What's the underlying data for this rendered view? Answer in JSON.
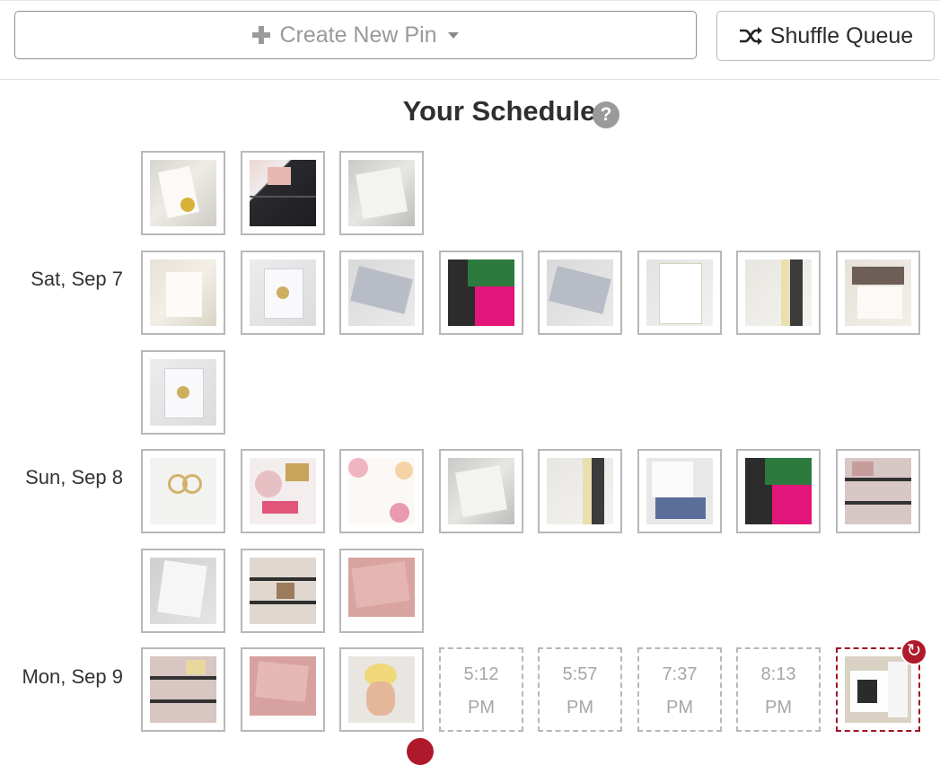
{
  "toolbar": {
    "create_label": "Create New Pin",
    "shuffle_label": "Shuffle Queue"
  },
  "schedule": {
    "title": "Your Schedule",
    "help_glyph": "?",
    "days": [
      {
        "label": "Sat, Sep 7"
      },
      {
        "label": "Sun, Sep 8"
      },
      {
        "label": "Mon, Sep 9"
      }
    ],
    "open_slots": [
      {
        "time": "5:12",
        "meridiem": "PM"
      },
      {
        "time": "5:57",
        "meridiem": "PM"
      },
      {
        "time": "7:37",
        "meridiem": "PM"
      },
      {
        "time": "8:13",
        "meridiem": "PM"
      }
    ]
  },
  "icons": {
    "plus": "plus-icon",
    "caret": "caret-down-icon",
    "shuffle": "shuffle-icon",
    "help": "question-circle-icon",
    "sync": "sync-icon"
  },
  "colors": {
    "accent_red": "#b0182c",
    "tile_border": "#b8b8b8",
    "slot_text": "#a6a6a6"
  }
}
